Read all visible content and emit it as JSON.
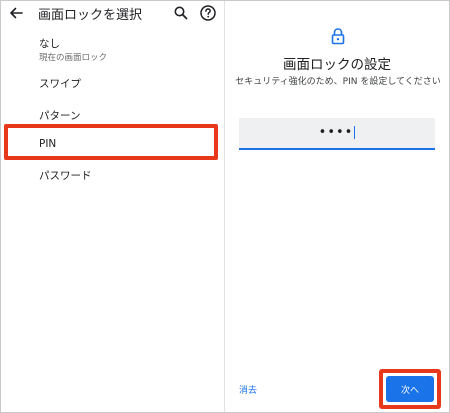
{
  "left": {
    "title": "画面ロックを選択",
    "options": [
      {
        "label": "なし",
        "sub": "現在の画面ロック"
      },
      {
        "label": "スワイプ"
      },
      {
        "label": "パターン"
      },
      {
        "label": "PIN"
      },
      {
        "label": "パスワード"
      }
    ],
    "highlighted_option": "PIN"
  },
  "right": {
    "title": "画面ロックの設定",
    "description": "セキュリティ強化のため、PIN を設定してください",
    "pin_value": "••••",
    "cancel_label": "消去",
    "next_label": "次へ"
  },
  "colors": {
    "accent": "#1a73e8",
    "highlight": "#e8381c",
    "pin_field_bg": "#eef0f2"
  },
  "icons": [
    "back-arrow-icon",
    "search-icon",
    "help-icon",
    "lock-icon"
  ]
}
